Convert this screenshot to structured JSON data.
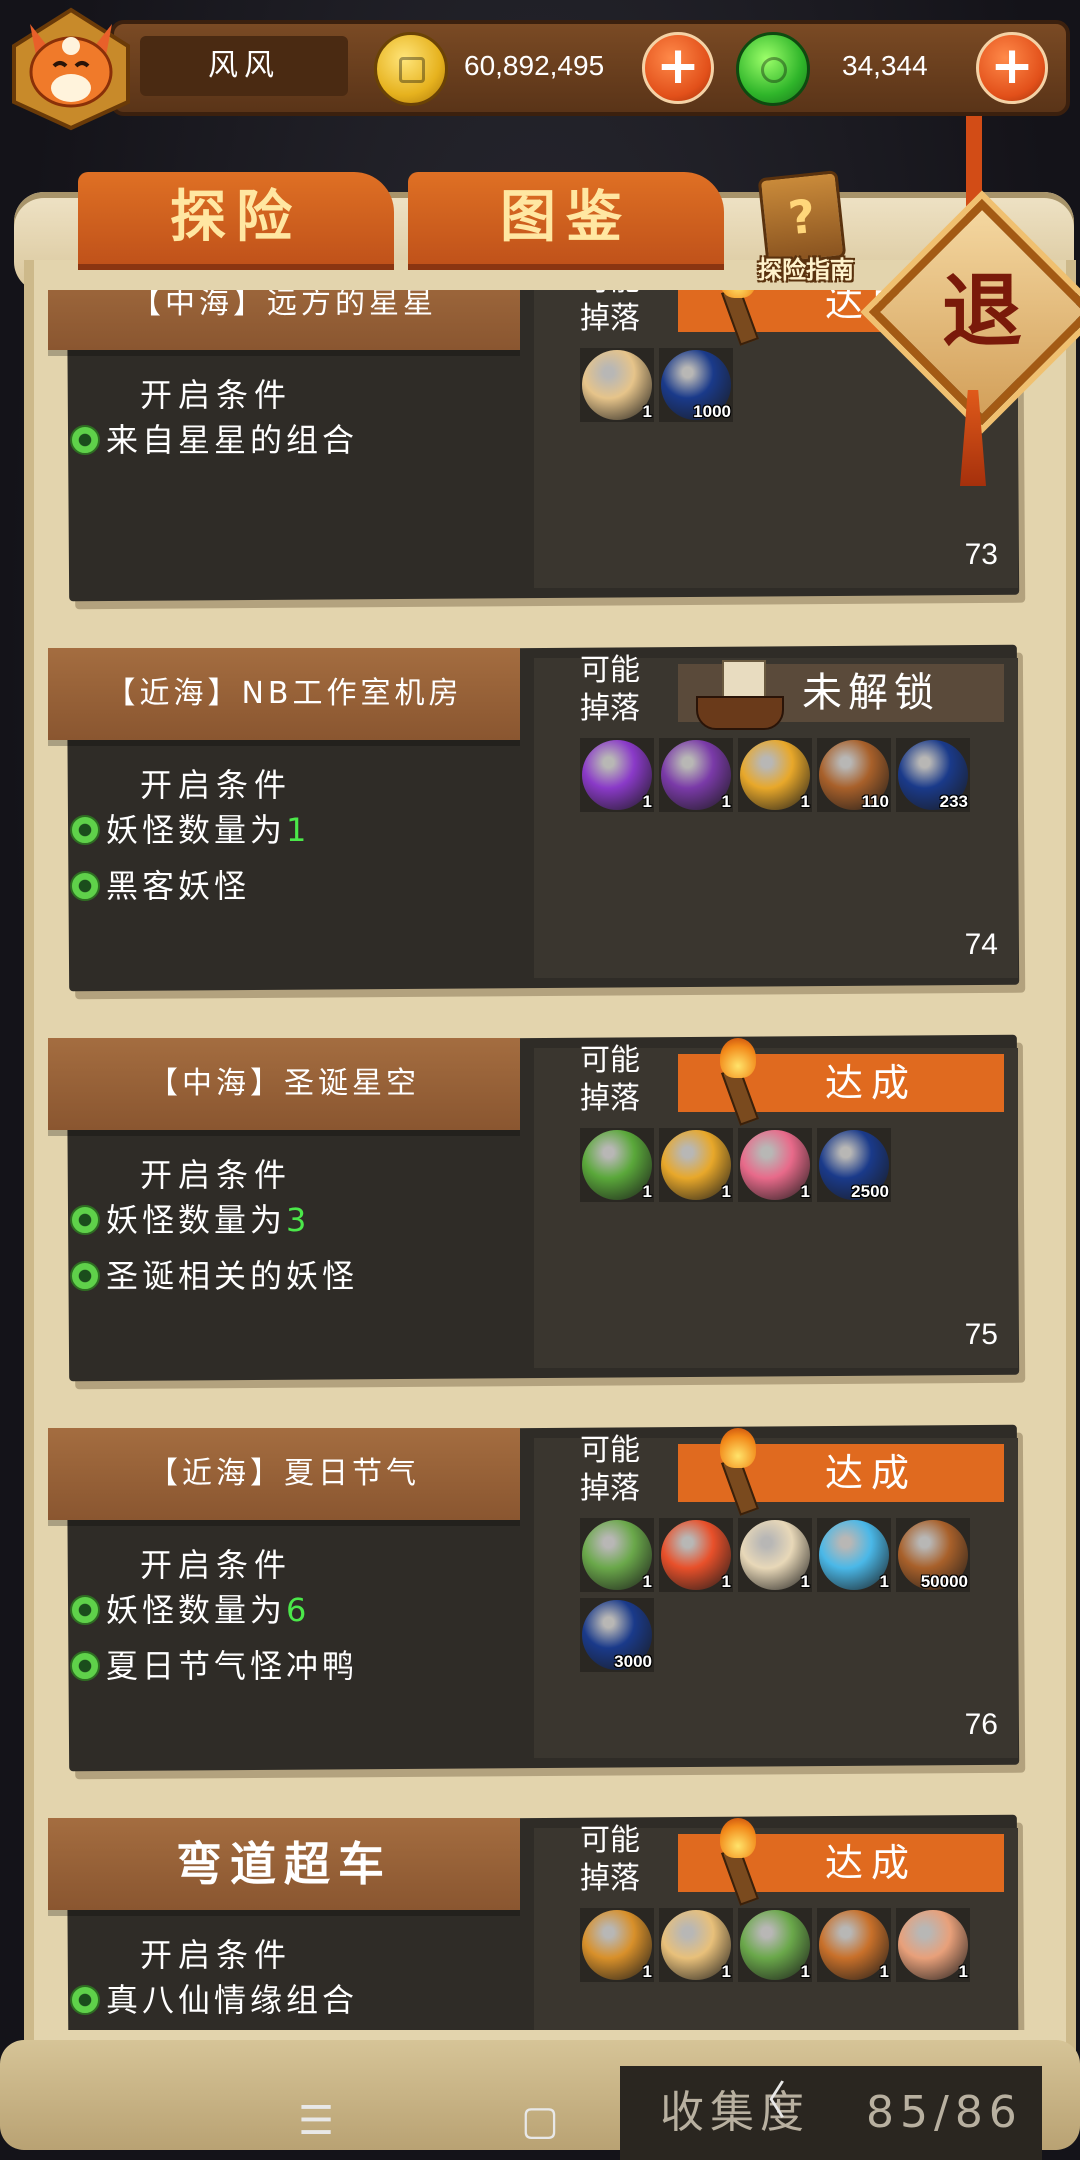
{
  "player": {
    "name": "风风",
    "gold": "60,892,495",
    "jade": "34,344"
  },
  "tabs": [
    "探险",
    "图鉴"
  ],
  "guide_label": "探险指南",
  "exit_label": "退",
  "drop_label_1": "可能",
  "drop_label_2": "掉落",
  "cond_head": "开启条件",
  "cards": [
    {
      "title": "【中海】远方的星星",
      "status": "达成",
      "locked": false,
      "conds": [
        {
          "text": "来自星星的组合",
          "num": ""
        }
      ],
      "items": [
        {
          "icon": "star-sun-icon",
          "color": "#e6c48a",
          "count": "1"
        },
        {
          "icon": "blue-flame-icon",
          "color": "#1a3a8a",
          "count": "1000"
        }
      ],
      "no": "73"
    },
    {
      "title": "【近海】NB工作室机房",
      "status": "未解锁",
      "locked": true,
      "conds": [
        {
          "text": "妖怪数量为",
          "num": "1"
        },
        {
          "text": "黑客妖怪",
          "num": ""
        }
      ],
      "items": [
        {
          "icon": "purple-eye-icon",
          "color": "#8a3ac8",
          "count": "1"
        },
        {
          "icon": "demon-mask-icon",
          "color": "#7a3aa8",
          "count": "1"
        },
        {
          "icon": "golden-beetle-icon",
          "color": "#e8a82a",
          "count": "1"
        },
        {
          "icon": "gold-bag-icon",
          "color": "#a8602a",
          "count": "110"
        },
        {
          "icon": "blue-flame-icon",
          "color": "#1a3a8a",
          "count": "233"
        }
      ],
      "no": "74"
    },
    {
      "title": "【中海】圣诞星空",
      "status": "达成",
      "locked": false,
      "conds": [
        {
          "text": "妖怪数量为",
          "num": "3"
        },
        {
          "text": "圣诞相关的妖怪",
          "num": ""
        }
      ],
      "items": [
        {
          "icon": "holly-icon",
          "color": "#5aa83a",
          "count": "1"
        },
        {
          "icon": "bell-icon",
          "color": "#e8a82a",
          "count": "1"
        },
        {
          "icon": "candy-cane-icon",
          "color": "#e86a8a",
          "count": "1"
        },
        {
          "icon": "blue-flame-icon",
          "color": "#1a3a8a",
          "count": "2500"
        }
      ],
      "no": "75"
    },
    {
      "title": "【近海】夏日节气",
      "status": "达成",
      "locked": false,
      "conds": [
        {
          "text": "妖怪数量为",
          "num": "6"
        },
        {
          "text": "夏日节气怪冲鸭",
          "num": ""
        }
      ],
      "items": [
        {
          "icon": "leaf-icon",
          "color": "#6aa84a",
          "count": "1"
        },
        {
          "icon": "fire-rune-icon",
          "color": "#e8502a",
          "count": "1"
        },
        {
          "icon": "rice-cake-icon",
          "color": "#e8d8b8",
          "count": "1"
        },
        {
          "icon": "ice-crystal-icon",
          "color": "#4ab8e8",
          "count": "1"
        },
        {
          "icon": "gold-bag-icon",
          "color": "#a8602a",
          "count": "50000"
        },
        {
          "icon": "blue-flame-icon",
          "color": "#1a3a8a",
          "count": "3000"
        }
      ],
      "no": "76"
    },
    {
      "title": "弯道超车",
      "status": "达成",
      "locked": false,
      "big": true,
      "conds": [
        {
          "text": "真八仙情缘组合",
          "num": ""
        }
      ],
      "items": [
        {
          "icon": "treasure-box-icon",
          "color": "#d8902a",
          "count": "1"
        },
        {
          "icon": "sword-icon",
          "color": "#e8c07a",
          "count": "1"
        },
        {
          "icon": "axe-icon",
          "color": "#6aa84a",
          "count": "1"
        },
        {
          "icon": "lantern-icon",
          "color": "#c8702a",
          "count": "1"
        },
        {
          "icon": "gourd-icon",
          "color": "#e8a07a",
          "count": "1"
        }
      ],
      "no": ""
    }
  ],
  "collection": {
    "label": "收集度",
    "value": "85/86"
  },
  "nav": {
    "menu": "☰",
    "home": "▢",
    "back": "〈"
  }
}
